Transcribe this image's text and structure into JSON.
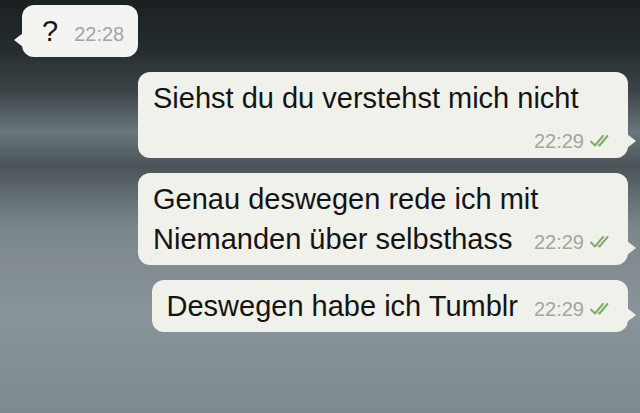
{
  "chat": {
    "messages": [
      {
        "kind": "incoming",
        "text": "?",
        "time": "22:28",
        "delivered": false
      },
      {
        "kind": "outgoing",
        "text": "Siehst du du verstehst mich nicht",
        "time": "22:29",
        "delivered": true
      },
      {
        "kind": "outgoing",
        "text": "Genau deswegen rede ich mit Niemanden über selbsthass",
        "time": "22:29",
        "delivered": true
      },
      {
        "kind": "outgoing",
        "text": "Deswegen habe ich Tumblr",
        "time": "22:29",
        "delivered": true
      }
    ]
  }
}
